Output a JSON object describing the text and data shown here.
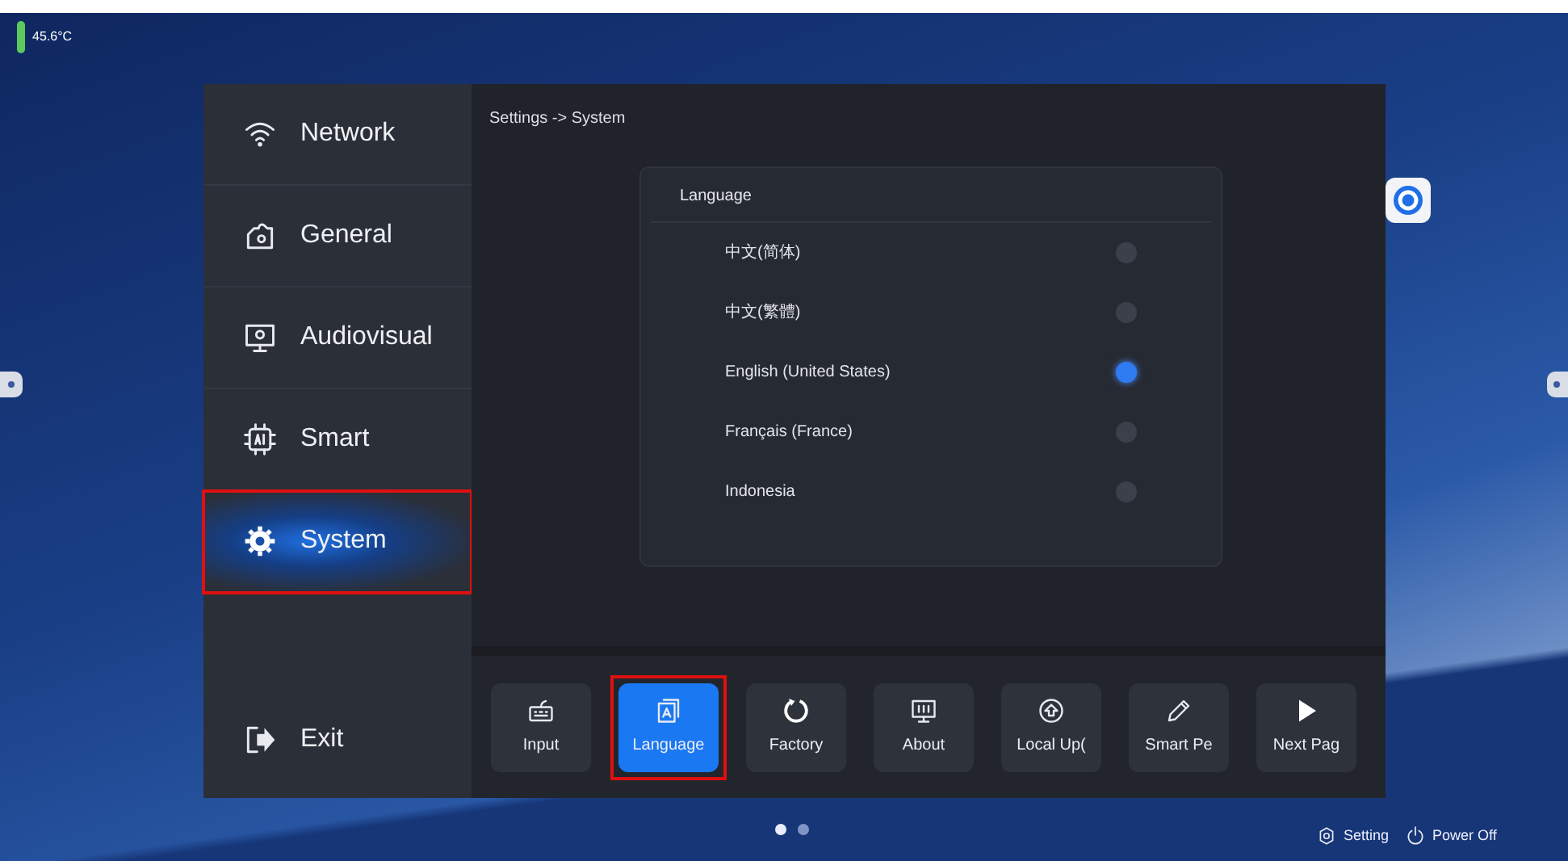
{
  "status": {
    "temperature": "45.6°C"
  },
  "sidebar": {
    "items": [
      {
        "label": "Network",
        "selected": false,
        "annotated": false
      },
      {
        "label": "General",
        "selected": false,
        "annotated": false
      },
      {
        "label": "Audiovisual",
        "selected": false,
        "annotated": false
      },
      {
        "label": "Smart",
        "selected": false,
        "annotated": false
      },
      {
        "label": "System",
        "selected": true,
        "annotated": true
      }
    ],
    "exit": {
      "label": "Exit"
    }
  },
  "breadcrumb": "Settings -> System",
  "language_panel": {
    "title": "Language",
    "options": [
      {
        "label": "中文(简体)",
        "selected": false
      },
      {
        "label": "中文(繁體)",
        "selected": false
      },
      {
        "label": "English (United States)",
        "selected": true
      },
      {
        "label": "Français (France)",
        "selected": false
      },
      {
        "label": "Indonesia",
        "selected": false
      }
    ]
  },
  "toolbar": [
    {
      "label": "Input",
      "selected": false,
      "annotated": false
    },
    {
      "label": "Language",
      "selected": true,
      "annotated": true
    },
    {
      "label": "Factory",
      "selected": false,
      "annotated": false
    },
    {
      "label": "About",
      "selected": false,
      "annotated": false
    },
    {
      "label": "Local Up(",
      "selected": false,
      "annotated": false
    },
    {
      "label": "Smart Pe",
      "selected": false,
      "annotated": false
    },
    {
      "label": "Next Pag",
      "selected": false,
      "annotated": false
    }
  ],
  "pager": [
    {
      "selected": true
    },
    {
      "selected": false
    }
  ],
  "bottom_actions": [
    {
      "label": "Setting"
    },
    {
      "label": "Power Off"
    }
  ]
}
